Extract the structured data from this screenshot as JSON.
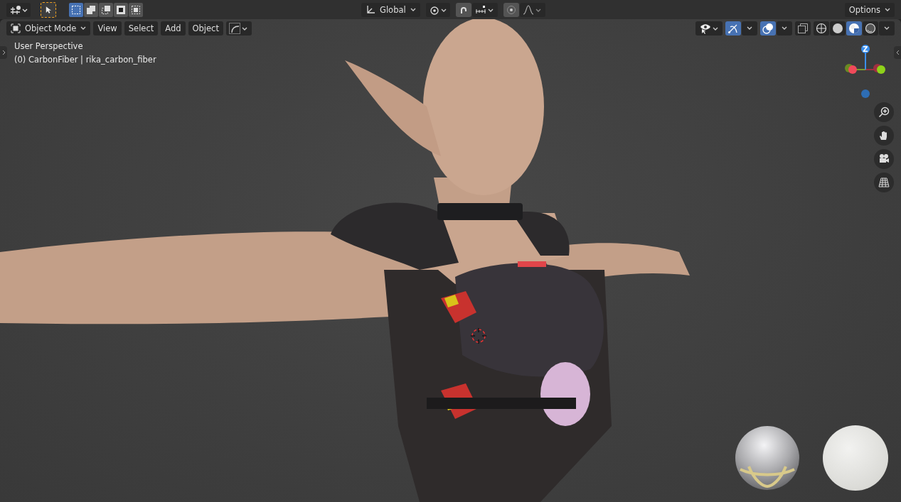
{
  "top_header": {
    "select_modes": [
      {
        "selected": true
      },
      {
        "selected": false
      },
      {
        "selected": false
      },
      {
        "selected": false
      },
      {
        "selected": false
      }
    ],
    "transform_orientation": "Global",
    "options_label": "Options"
  },
  "viewport_header": {
    "mode": "Object Mode",
    "menus": [
      "View",
      "Select",
      "Add",
      "Object"
    ],
    "gizmos_on": true,
    "overlays_on": true,
    "shading_modes": [
      {
        "selected": false
      },
      {
        "selected": false
      },
      {
        "selected": true
      },
      {
        "selected": false
      }
    ]
  },
  "viewport": {
    "info_lines": [
      "User Perspective",
      "(0) CarbonFiber | rika_carbon_fiber"
    ],
    "gizmo_axis_label": "Z"
  }
}
